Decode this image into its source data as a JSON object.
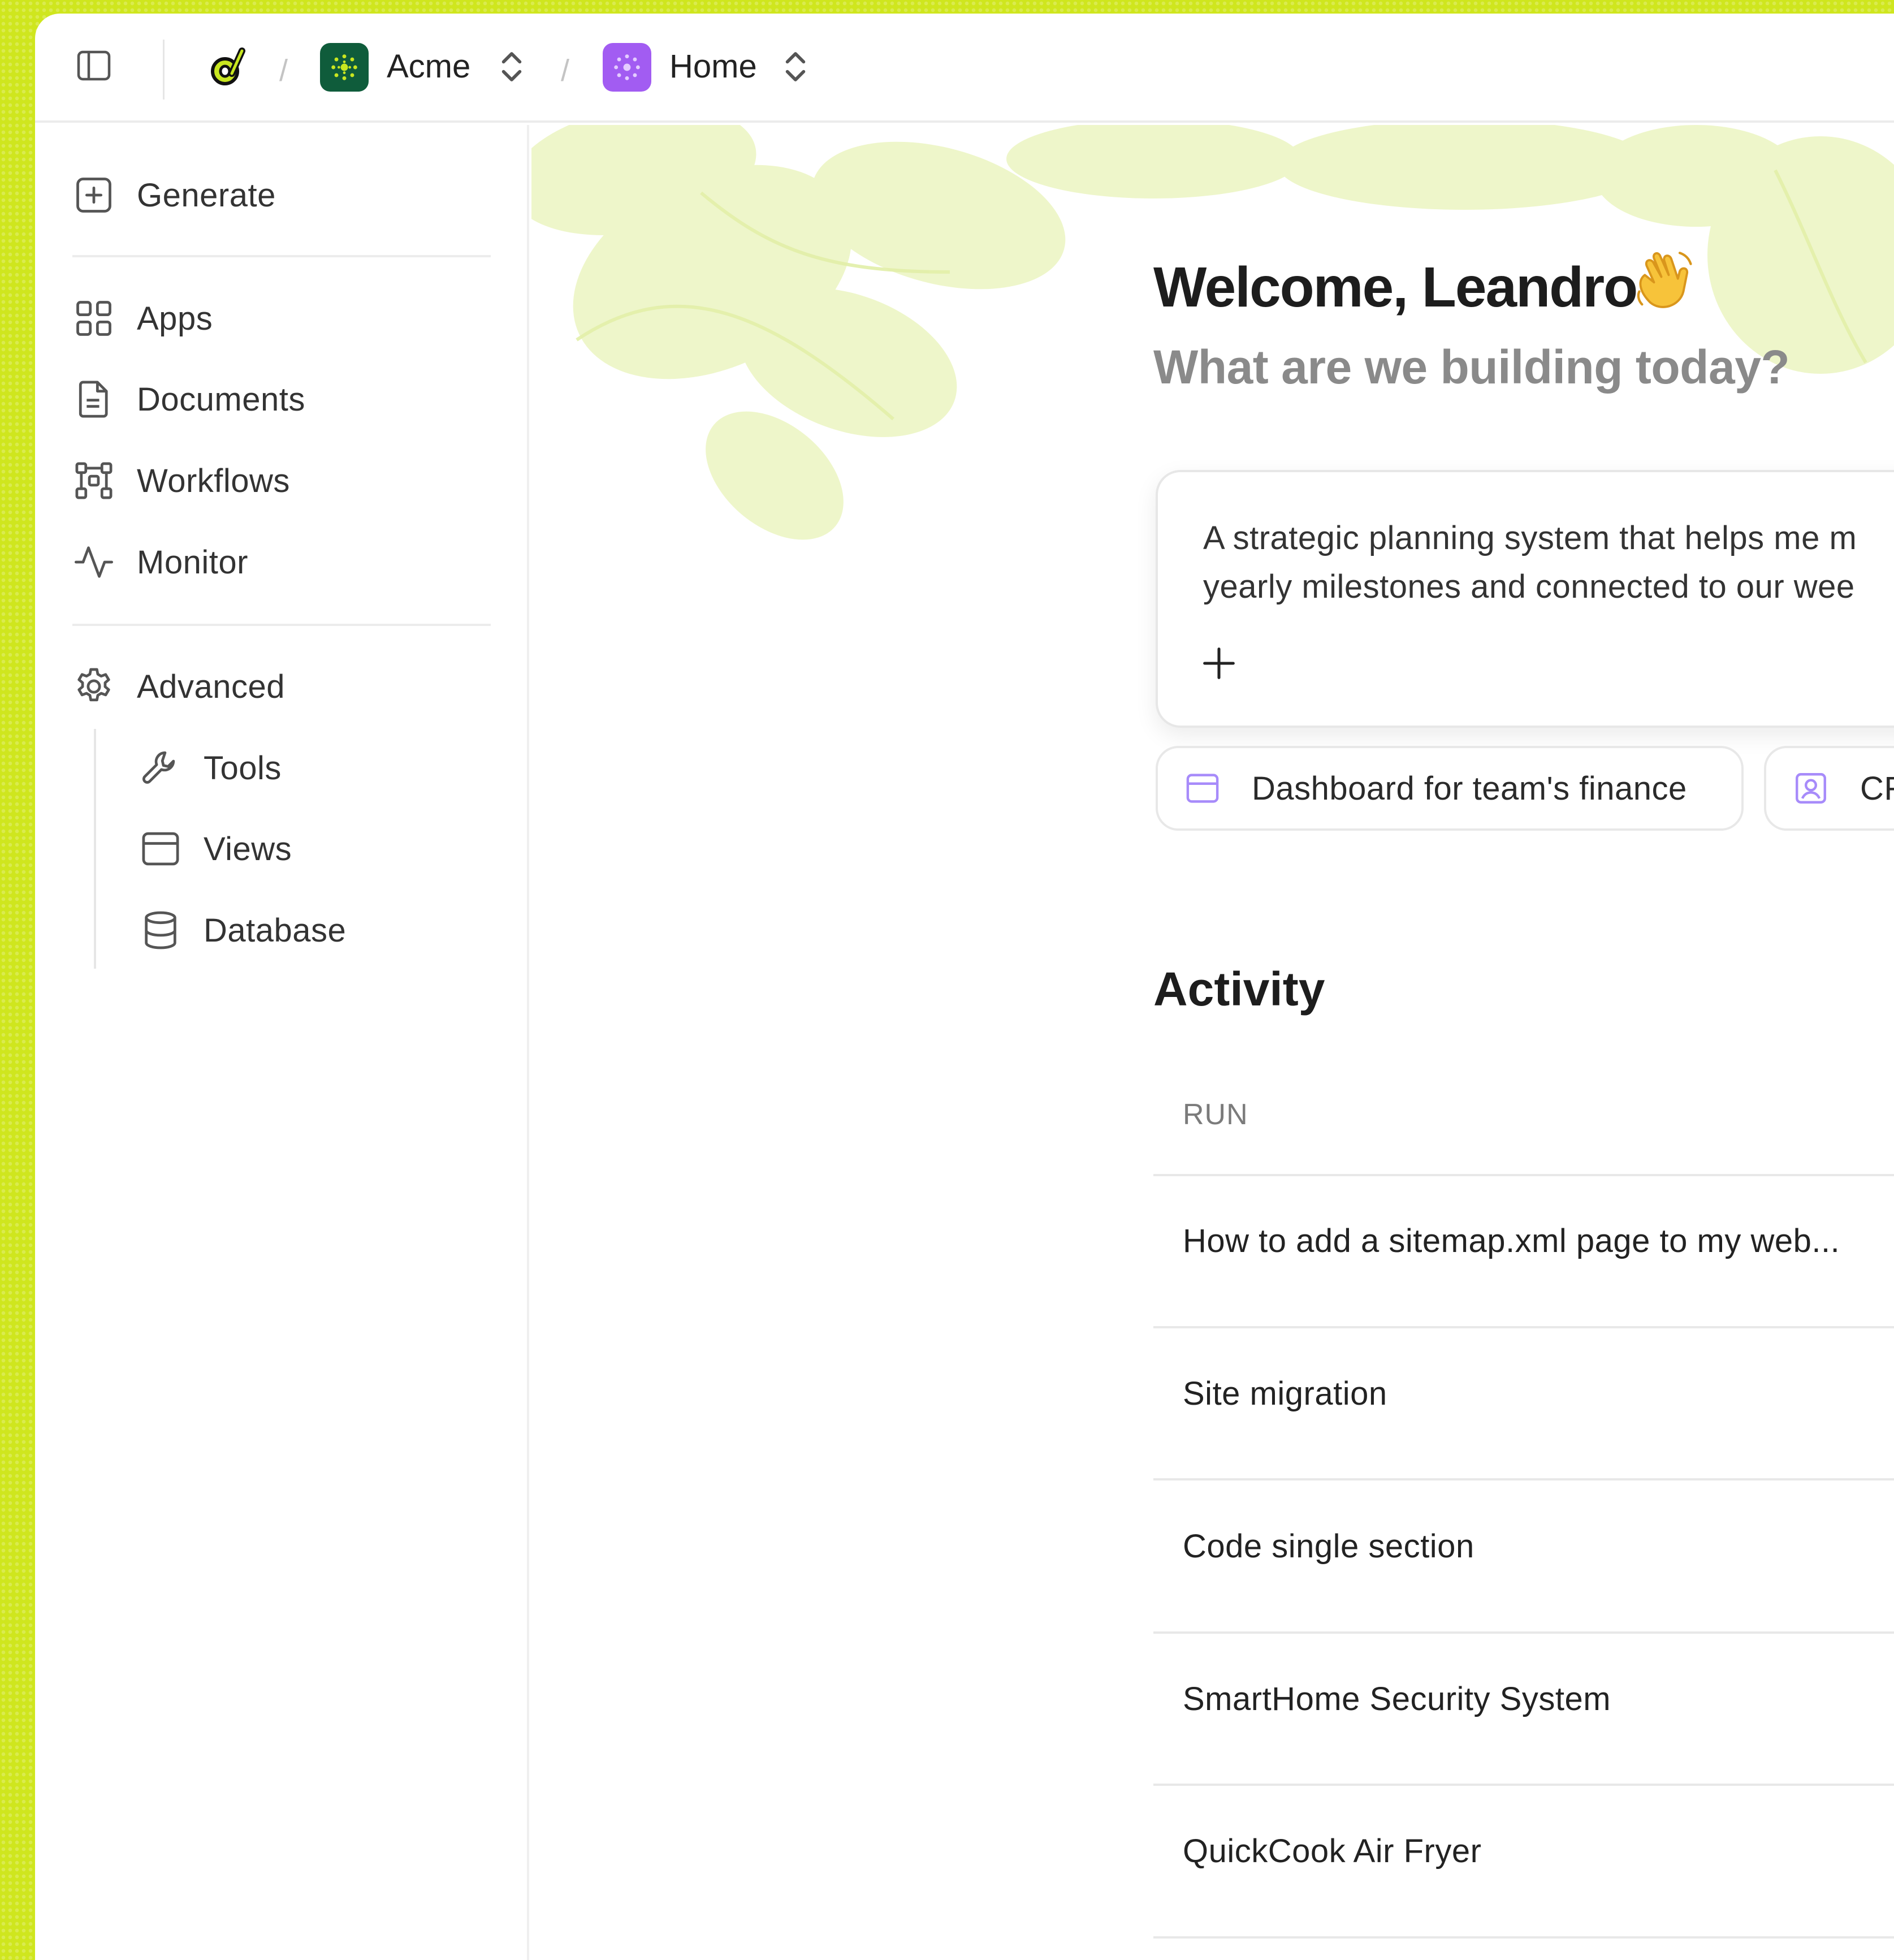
{
  "breadcrumb": {
    "separator": "/",
    "workspace": "Acme",
    "project": "Home"
  },
  "sidebar": {
    "generate": "Generate",
    "items": [
      "Apps",
      "Documents",
      "Workflows",
      "Monitor"
    ],
    "advanced": "Advanced",
    "sub_items": [
      "Tools",
      "Views",
      "Database"
    ]
  },
  "main": {
    "welcome": "Welcome, Leandro",
    "subtitle": "What are we building today?",
    "prompt_text": "A strategic planning system that helps me m\nyearly milestones and connected to our wee",
    "suggestions": [
      "Dashboard for team's finance",
      "CR"
    ],
    "activity_title": "Activity",
    "column_run": "RUN",
    "runs": [
      "How to add a sitemap.xml page to my web...",
      "Site migration",
      "Code single section",
      "SmartHome Security System",
      "QuickCook Air Fryer"
    ]
  },
  "colors": {
    "brand_lime": "#cfe61e",
    "workspace_badge": "#0f5c3b",
    "project_badge": "#a25cf2",
    "chip_icon": "#a78bfa"
  },
  "icons": {
    "sidebar_toggle": "sidebar-toggle-icon",
    "logo": "logo-icon",
    "generate": "plus-square-icon",
    "apps": "grid-icon",
    "documents": "document-icon",
    "workflows": "workflow-icon",
    "monitor": "activity-pulse-icon",
    "advanced": "gear-icon",
    "tools": "wrench-icon",
    "views": "window-icon",
    "database": "database-icon"
  }
}
